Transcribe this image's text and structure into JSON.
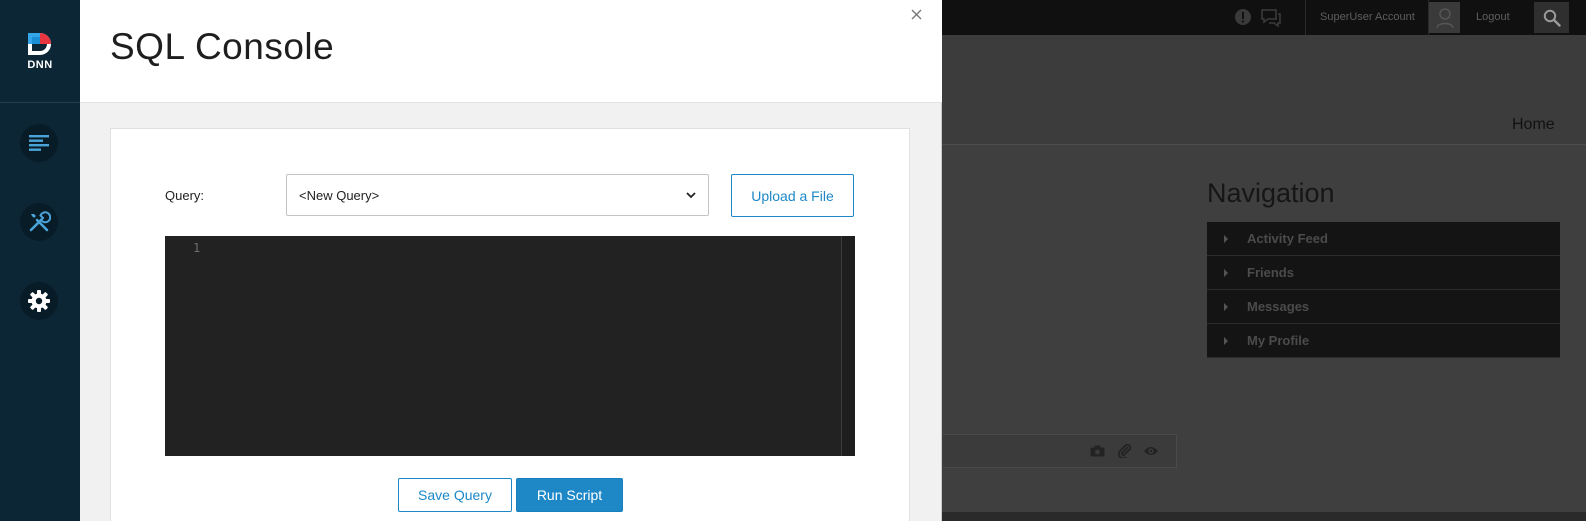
{
  "site": {
    "topbar": {
      "account_name": "SuperUser Account",
      "logout_label": "Logout"
    },
    "home_label": "Home",
    "navigation": {
      "title": "Navigation",
      "items": [
        {
          "label": "Activity Feed"
        },
        {
          "label": "Friends"
        },
        {
          "label": "Messages"
        },
        {
          "label": "My Profile"
        }
      ]
    }
  },
  "persona_bar": {
    "logo_text": "DNN",
    "buttons": [
      {
        "icon": "content-icon"
      },
      {
        "icon": "tools-icon"
      },
      {
        "icon": "gear-icon"
      }
    ]
  },
  "sql_console": {
    "title": "SQL Console",
    "query_label": "Query:",
    "query_select_value": "<New Query>",
    "upload_label": "Upload a File",
    "editor": {
      "line_numbers": [
        "1"
      ],
      "content": ""
    },
    "save_label": "Save Query",
    "run_label": "Run Script"
  },
  "colors": {
    "accent": "#1e88c7",
    "persona_bg": "#0c2636",
    "editor_bg": "#222222"
  }
}
